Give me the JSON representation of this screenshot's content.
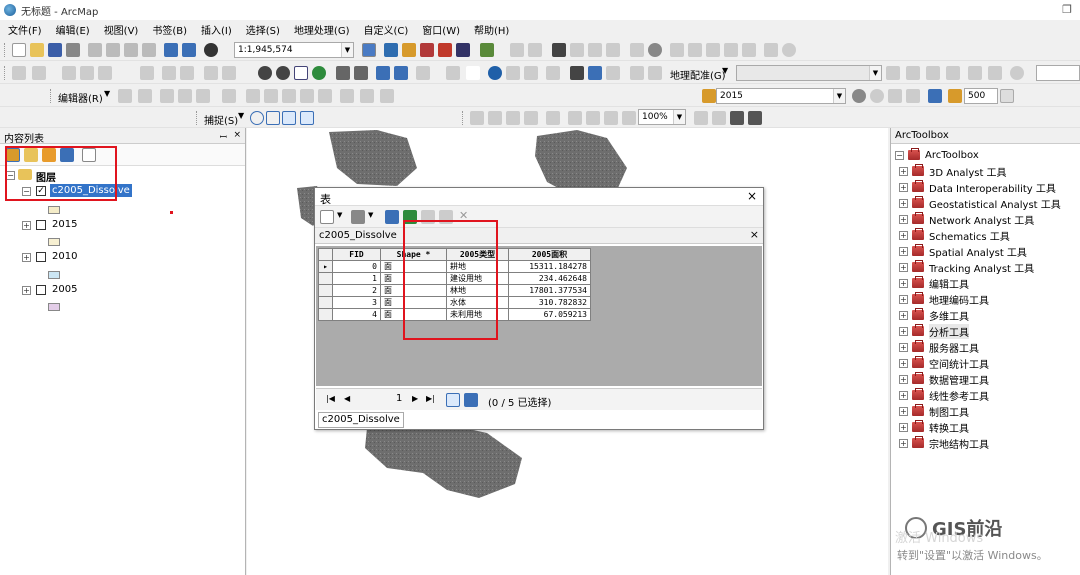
{
  "window": {
    "title": "无标题 - ArcMap"
  },
  "menu": [
    "文件(F)",
    "编辑(E)",
    "视图(V)",
    "书签(B)",
    "插入(I)",
    "选择(S)",
    "地理处理(G)",
    "自定义(C)",
    "窗口(W)",
    "帮助(H)"
  ],
  "toolbar": {
    "scale": "1:1,945,574",
    "georef_label": "地理配准(G)",
    "editor_label": "编辑器(R)",
    "snapping_label": "捕捉(S)",
    "layer_combo": "2015",
    "zoom_combo": "100%",
    "number_field": "500"
  },
  "toc": {
    "title": "内容列表",
    "pin": "ꟷ",
    "close": "×",
    "group": "图层",
    "layers": [
      {
        "name": "c2005_Dissolve",
        "checked": "✓",
        "swatch": "#f4ecc8"
      },
      {
        "name": "2015",
        "checked": "",
        "swatch": "#f7f0d2"
      },
      {
        "name": "2010",
        "checked": "",
        "swatch": "#cce6f4"
      },
      {
        "name": "2005",
        "checked": "",
        "swatch": "#e3cde8"
      }
    ]
  },
  "toolbox": {
    "title": "ArcToolbox",
    "root": "ArcToolbox",
    "items": [
      "3D Analyst 工具",
      "Data Interoperability 工具",
      "Geostatistical Analyst 工具",
      "Network Analyst 工具",
      "Schematics 工具",
      "Spatial Analyst 工具",
      "Tracking Analyst 工具",
      "编辑工具",
      "地理编码工具",
      "多维工具",
      "分析工具",
      "服务器工具",
      "空间统计工具",
      "数据管理工具",
      "线性参考工具",
      "制图工具",
      "转换工具",
      "宗地结构工具"
    ]
  },
  "table": {
    "title": "表",
    "close": "×",
    "tab_name": "c2005_Dissolve",
    "columns": [
      "FID",
      "Shape *",
      "2005类型",
      "2005面积"
    ],
    "rows": [
      [
        "0",
        "面",
        "耕地",
        "15311.184278"
      ],
      [
        "1",
        "面",
        "建设用地",
        "234.462648"
      ],
      [
        "2",
        "面",
        "林地",
        "17801.377534"
      ],
      [
        "3",
        "面",
        "水体",
        "310.782832"
      ],
      [
        "4",
        "面",
        "未利用地",
        "67.059213"
      ]
    ],
    "nav_page": "1",
    "selection_status": "(0 / 5 已选择)",
    "bottom_tab": "c2005_Dissolve"
  },
  "watermark": {
    "line1": "激活 Windows",
    "line2": "转到\"设置\"以激活 Windows。",
    "logo": "GIS前沿"
  }
}
